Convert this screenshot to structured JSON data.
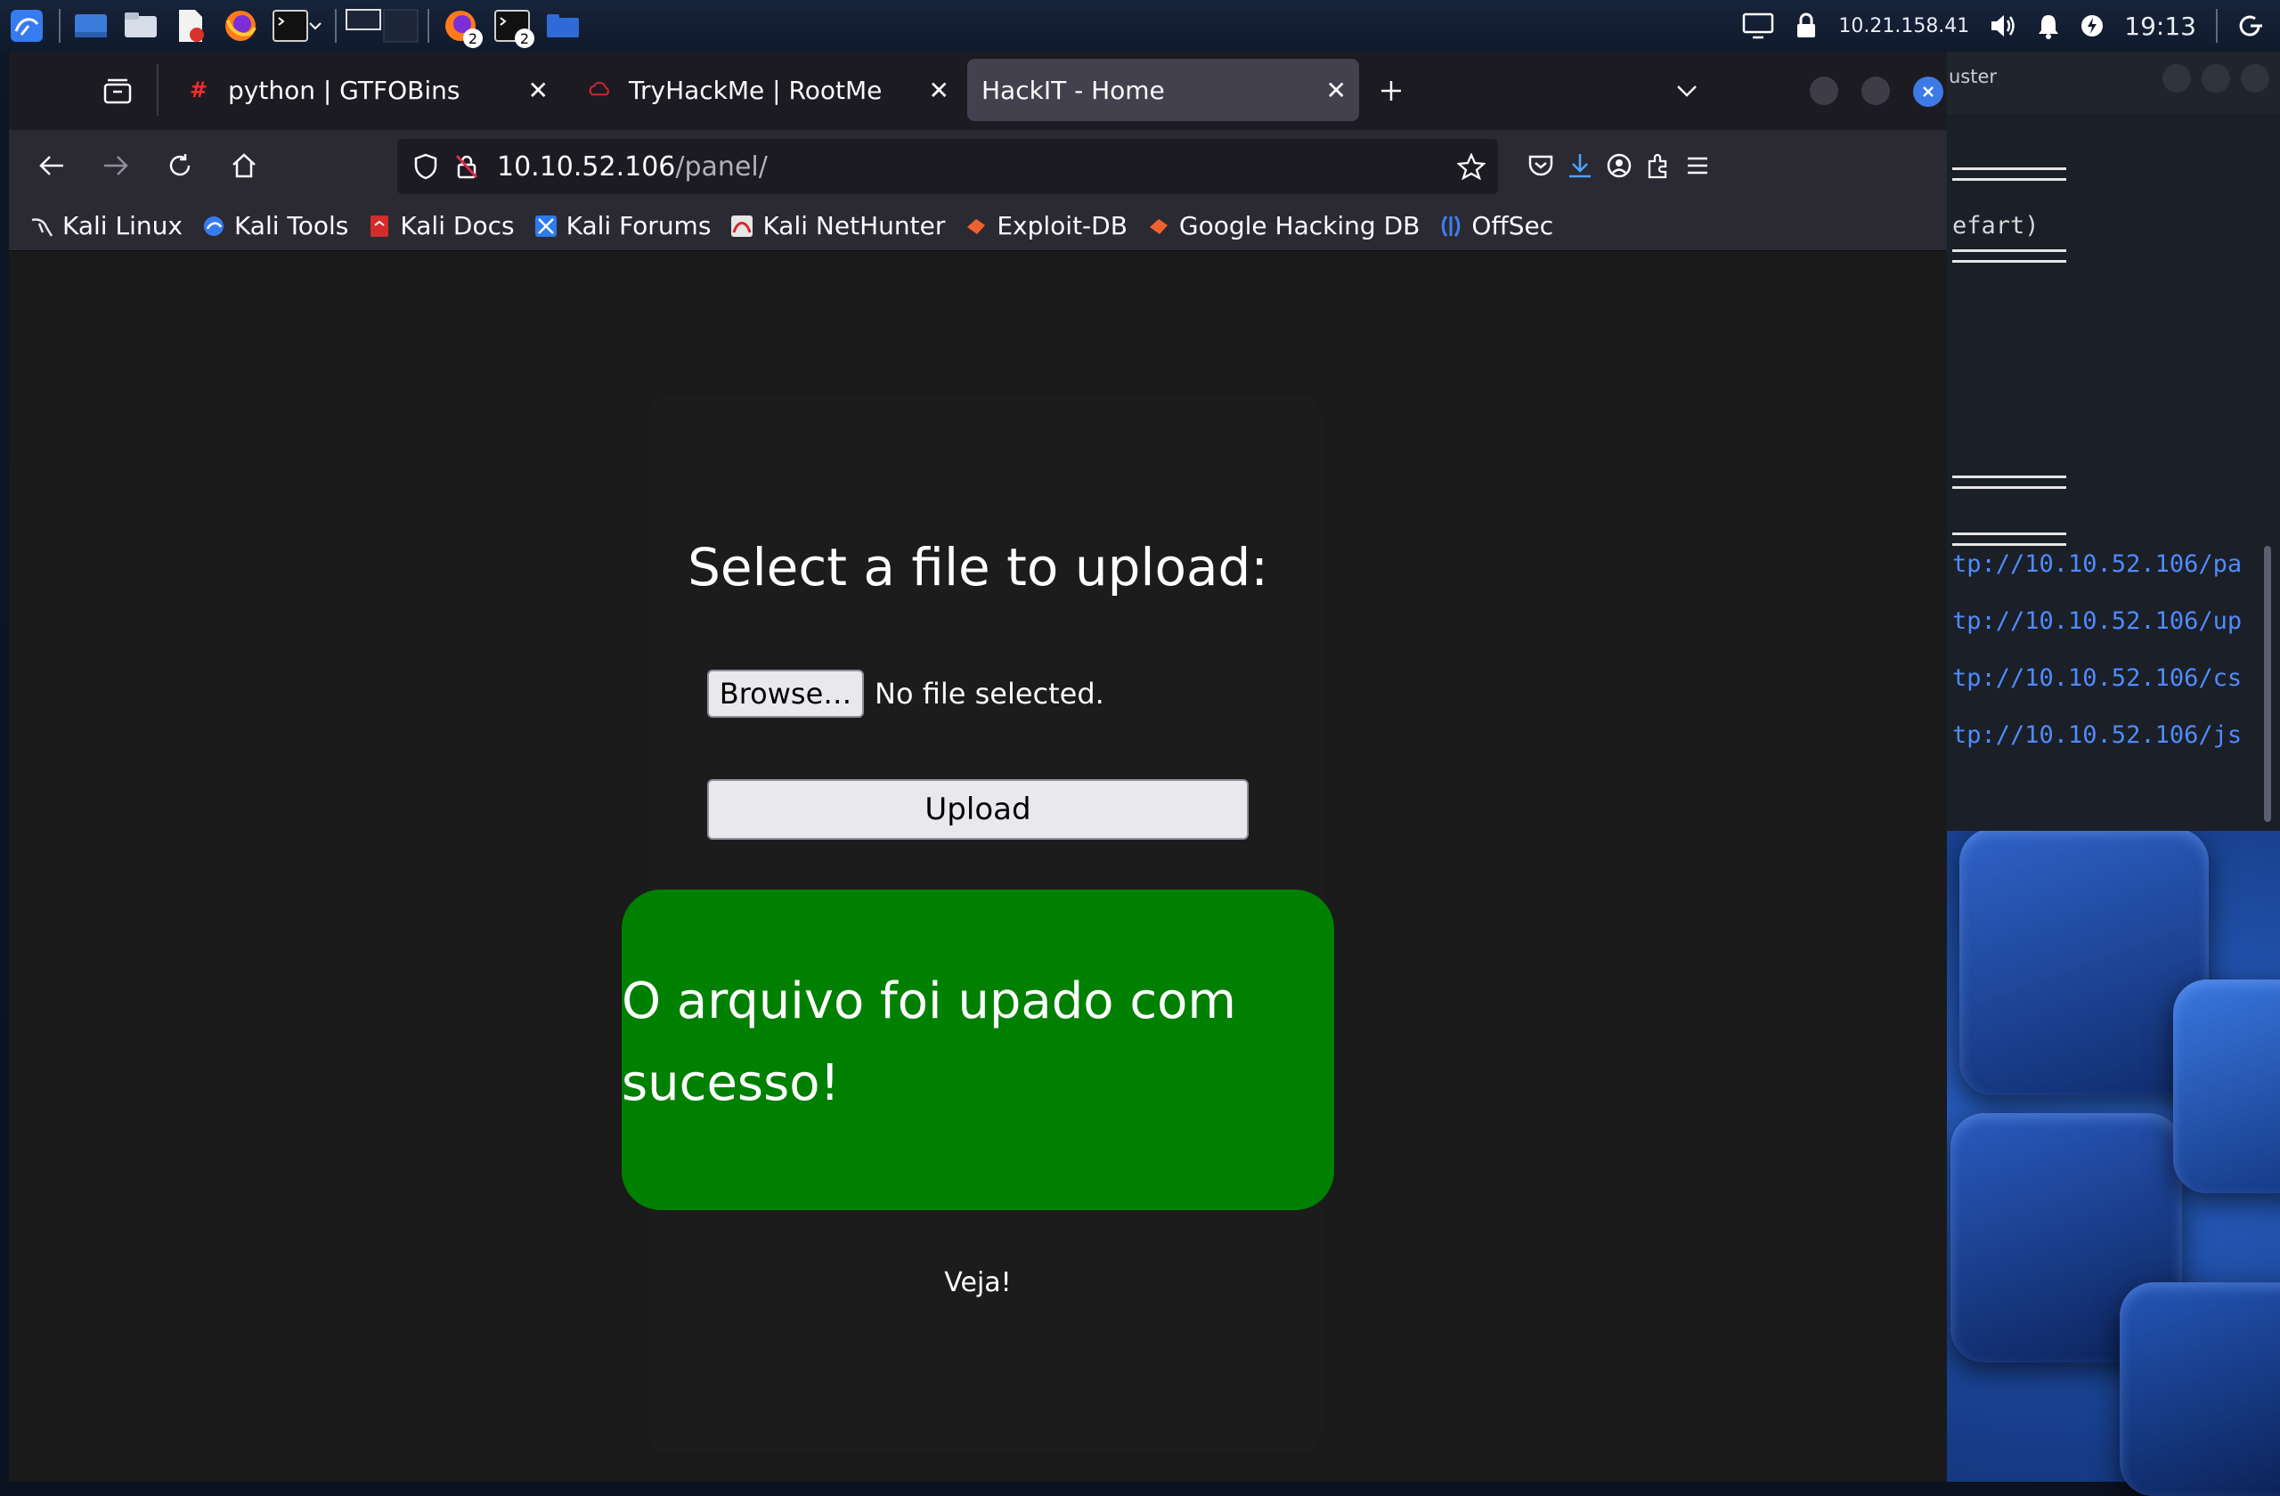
{
  "panel": {
    "ip": "10.21.158.41",
    "clock": "19:13",
    "badges": [
      "2",
      "2"
    ]
  },
  "terminal": {
    "title": "uster",
    "lines": [
      "efart)"
    ],
    "links": [
      "tp://10.10.52.106/pa",
      "tp://10.10.52.106/up",
      "tp://10.10.52.106/cs",
      "tp://10.10.52.106/js"
    ]
  },
  "browser": {
    "tabs": [
      {
        "label": "python | GTFOBins",
        "icon": "#"
      },
      {
        "label": "TryHackMe | RootMe",
        "icon": ""
      },
      {
        "label": "HackIT - Home",
        "icon": ""
      }
    ],
    "url": {
      "host": "10.10.52.106",
      "path": "/panel/"
    },
    "bookmarks": [
      "Kali Linux",
      "Kali Tools",
      "Kali Docs",
      "Kali Forums",
      "Kali NetHunter",
      "Exploit-DB",
      "Google Hacking DB",
      "OffSec"
    ]
  },
  "page": {
    "heading": "Select a file to upload:",
    "browse_label": "Browse…",
    "no_file": "No file selected.",
    "upload_label": "Upload",
    "success_message": "O arquivo foi upado com sucesso!",
    "link_text": "Veja!"
  },
  "colors": {
    "success_bg": "#008000",
    "accent": "#4f8bff",
    "page_bg": "#1a1a1a"
  }
}
